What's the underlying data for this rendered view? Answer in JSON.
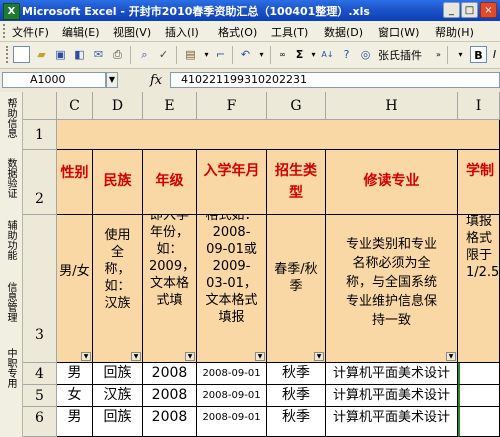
{
  "window": {
    "app_icon": "excel-icon",
    "title": "Microsoft Excel - 开封市2010春季资助汇总（100401整理）.xls",
    "buttons": [
      "_",
      "□",
      "×"
    ]
  },
  "menu": [
    "文件(F)",
    "编辑(E)",
    "视图(V)",
    "插入(I)",
    "格式(O)",
    "工具(T)",
    "数据(D)",
    "窗口(W)",
    "帮助(H)"
  ],
  "toolbar": {
    "plugin_label": "张氏插件",
    "sigma": "Σ",
    "bold": "B",
    "italic": "I"
  },
  "formula_bar": {
    "name_box": "A1000",
    "fx": "fx",
    "value": "410221199310202231"
  },
  "left_toolbar": [
    "帮助信息",
    "数据验证",
    "辅助功能",
    "信息管理",
    "中职专用"
  ],
  "sheet": {
    "columns": [
      "C",
      "D",
      "E",
      "F",
      "G",
      "H",
      "I"
    ],
    "row_numbers": [
      "1",
      "2",
      "3",
      "4",
      "5",
      "6"
    ],
    "headers": [
      "性别",
      "民族",
      "年级",
      "入学年月",
      "招生类型",
      "修读专业",
      "学制"
    ],
    "instructions": [
      "男/女",
      "使用全称，如：汉族",
      "即入学年份，如：2009，文本格式填",
      "格式如：2008-09-01或2009-03-01，文本格式填报",
      "春季/秋季",
      "专业类别和专业名称必须为全称，与全国系统专业维护信息保持一致",
      "填报格式限于1/2.5"
    ],
    "rows": [
      [
        "男",
        "回族",
        "2008",
        "2008-09-01",
        "秋季",
        "计算机平面美术设计"
      ],
      [
        "女",
        "汉族",
        "2008",
        "2008-09-01",
        "秋季",
        "计算机平面美术设计"
      ],
      [
        "男",
        "回族",
        "2008",
        "2008-09-01",
        "秋季",
        "计算机平面美术设计"
      ]
    ]
  },
  "colors": {
    "title_bar": "#0b3fb8",
    "header_fill": "#fad8a6",
    "header_text": "#d40000"
  }
}
